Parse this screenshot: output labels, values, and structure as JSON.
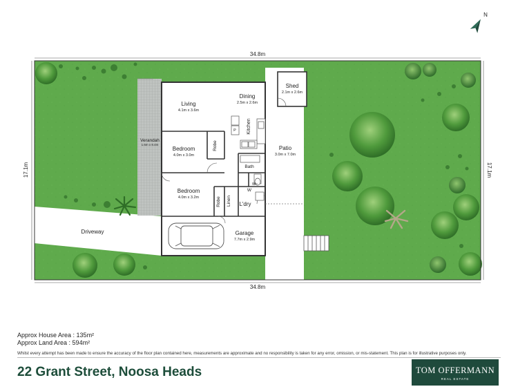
{
  "plan": {
    "dimension_top": "34.8m",
    "dimension_bottom": "34.8m",
    "dimension_left": "17.1m",
    "dimension_right": "17.1m",
    "north_label": "N",
    "rooms": {
      "living": {
        "name": "Living",
        "size": "4.1m x 3.6m"
      },
      "dining": {
        "name": "Dining",
        "size": "2.5m x 2.6m"
      },
      "kitchen": {
        "name": "Kitchen"
      },
      "pantry": {
        "name": "P"
      },
      "bedroom1": {
        "name": "Bedroom",
        "size": "4.0m x 3.0m"
      },
      "robe1": {
        "name": "Robe"
      },
      "bedroom2": {
        "name": "Bedroom",
        "size": "4.0m x 3.2m"
      },
      "robe2": {
        "name": "Robe"
      },
      "linen": {
        "name": "Linen"
      },
      "bath": {
        "name": "Bath"
      },
      "wc": {
        "name": "Wc"
      },
      "washer": {
        "name": "W"
      },
      "laundry": {
        "name": "L'dry"
      },
      "garage": {
        "name": "Garage",
        "size": "7.7m x 2.9m"
      },
      "verandah": {
        "name": "Verandah",
        "size": "1.6m x 8.4m"
      },
      "patio": {
        "name": "Patio",
        "size": "3.0m x 7.0m"
      },
      "shed": {
        "name": "Shed",
        "size": "2.1m x 2.6m"
      },
      "driveway": {
        "name": "Driveway"
      }
    }
  },
  "footer": {
    "house_area": "Approx House Area : 135m²",
    "land_area": "Approx Land Area : 594m²",
    "disclaimer": "Whilst every attempt has been made to ensure the accuracy of the floor plan contained here, measurements are approximate and no responsibility is taken for any error, omission, or mis-statement. This plan is for illustrative purposes only.",
    "address": "22 Grant Street, Noosa Heads"
  },
  "logo": {
    "name": "TOM OFFERMANN",
    "tagline": "REAL ESTATE"
  },
  "colors": {
    "lawn": "#5faa4c",
    "brand": "#1f4a3c",
    "title": "#1d4d3a",
    "paving": "#ffffff",
    "verandah": "#b4b8b5"
  }
}
